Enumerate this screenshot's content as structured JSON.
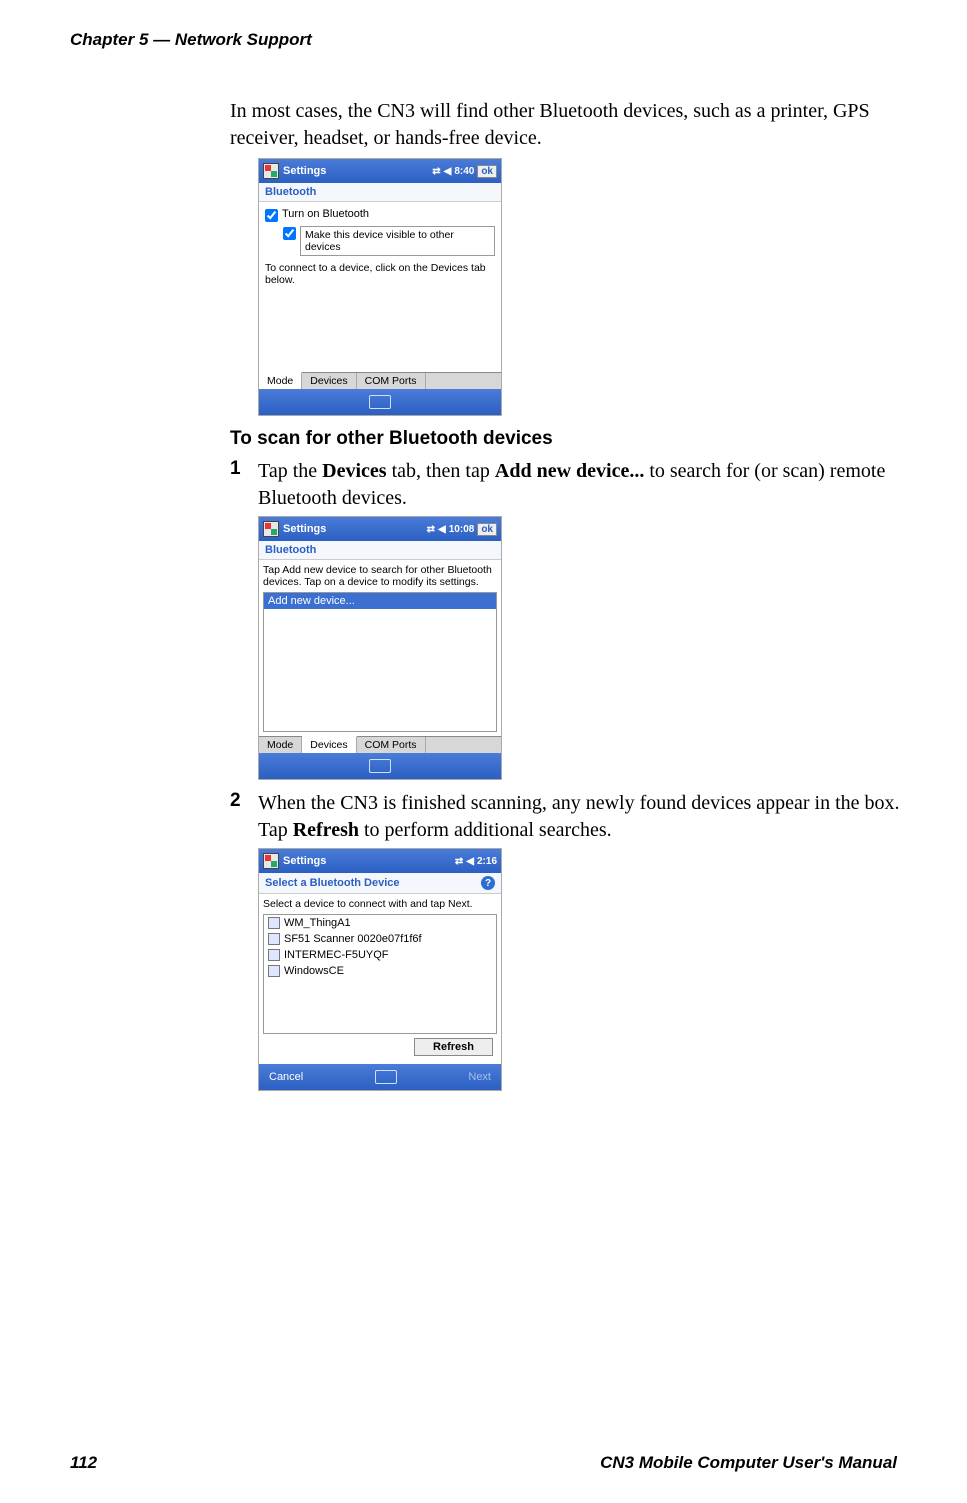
{
  "header": {
    "chapter": "Chapter 5 — Network Support"
  },
  "intro_para": "In most cases, the CN3 will find other Bluetooth devices, such as a printer, GPS receiver, headset, or hands-free device.",
  "shot1": {
    "title": "Settings",
    "time": "8:40",
    "ok": "ok",
    "section": "Bluetooth",
    "cb1": "Turn on Bluetooth",
    "cb2": "Make this device visible to other devices",
    "hint": "To connect to a device, click on the Devices tab below.",
    "tabs": [
      "Mode",
      "Devices",
      "COM Ports"
    ],
    "active_tab": 0
  },
  "subhead": "To scan for other Bluetooth devices",
  "step1": {
    "num": "1",
    "pre": "Tap the ",
    "b1": "Devices",
    "mid": " tab, then tap ",
    "b2": "Add new device...",
    "post": " to search for (or scan) remote Bluetooth devices."
  },
  "shot2": {
    "title": "Settings",
    "time": "10:08",
    "ok": "ok",
    "section": "Bluetooth",
    "hint": "Tap Add new device to search for other Bluetooth devices. Tap on a device to modify its settings.",
    "item": "Add new device...",
    "tabs": [
      "Mode",
      "Devices",
      "COM Ports"
    ],
    "active_tab": 1
  },
  "step2": {
    "num": "2",
    "pre": "When the CN3 is finished scanning, any newly found devices appear in the box. Tap ",
    "b1": "Refresh",
    "post": " to perform additional searches."
  },
  "shot3": {
    "title": "Settings",
    "time": "2:16",
    "section": "Select a Bluetooth Device",
    "hint": "Select a device to connect with and tap Next.",
    "devices": [
      "WM_ThingA1",
      "SF51 Scanner 0020e07f1f6f",
      "INTERMEC-F5UYQF",
      "WindowsCE"
    ],
    "refresh": "Refresh",
    "soft_left": "Cancel",
    "soft_right": "Next"
  },
  "footer": {
    "page": "112",
    "manual": "CN3 Mobile Computer User's Manual"
  }
}
